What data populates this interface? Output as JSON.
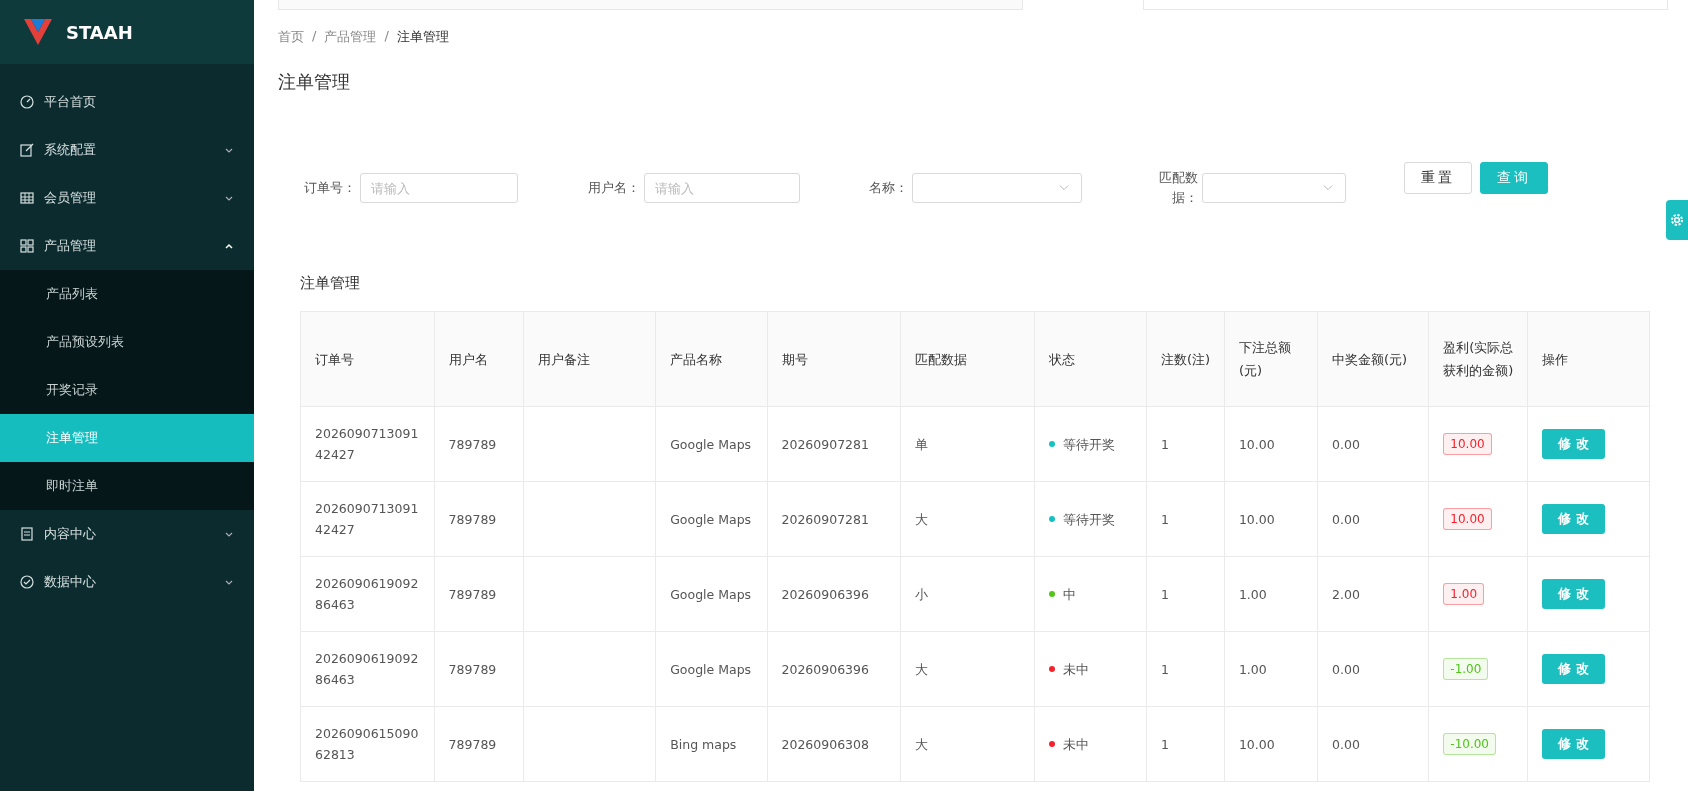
{
  "logo": {
    "text": "STAAH"
  },
  "sidebar": {
    "items": [
      {
        "label": "平台首页",
        "kind": "link",
        "selected": false
      },
      {
        "label": "系统配置",
        "kind": "group",
        "expanded": false
      },
      {
        "label": "会员管理",
        "kind": "group",
        "expanded": false
      },
      {
        "label": "产品管理",
        "kind": "group",
        "expanded": true,
        "children": [
          {
            "label": "产品列表",
            "selected": false
          },
          {
            "label": "产品预设列表",
            "selected": false
          },
          {
            "label": "开奖记录",
            "selected": false
          },
          {
            "label": "注单管理",
            "selected": true
          },
          {
            "label": "即时注单",
            "selected": false
          }
        ]
      },
      {
        "label": "内容中心",
        "kind": "group",
        "expanded": false
      },
      {
        "label": "数据中心",
        "kind": "group",
        "expanded": false
      }
    ]
  },
  "breadcrumb": {
    "separator": "/",
    "items": [
      "首页",
      "产品管理",
      "注单管理"
    ]
  },
  "page_title": "注单管理",
  "filters": [
    {
      "kind": "input",
      "label": "订单号：",
      "placeholder": "请输入"
    },
    {
      "kind": "input",
      "label": "用户名：",
      "placeholder": "请输入"
    },
    {
      "kind": "select",
      "label": "名称："
    },
    {
      "kind": "select",
      "label": "匹配数据："
    }
  ],
  "buttons": [
    {
      "kind": "default",
      "label": "重置"
    },
    {
      "kind": "primary",
      "label": "查询"
    }
  ],
  "table": {
    "title": "注单管理",
    "columns": [
      "订单号",
      "用户名",
      "用户备注",
      "产品名称",
      "期号",
      "匹配数据",
      "状态",
      "注数(注)",
      "下注总额(元)",
      "中奖金额(元)",
      "盈利(实际总获利的金额)",
      "操作"
    ],
    "rows": [
      {
        "order": "202609071309142427",
        "user": "789789",
        "product": "Google Maps",
        "period": "20260907281",
        "match": "单",
        "status": {
          "text": "等待开奖",
          "color": "#13c2c2"
        },
        "count": "1",
        "bet": "10.00",
        "win": "0.00",
        "profit": {
          "text": "10.00",
          "color": "#f5222d"
        },
        "action": "修 改"
      },
      {
        "order": "202609071309142427",
        "user": "789789",
        "product": "Google Maps",
        "period": "20260907281",
        "match": "大",
        "status": {
          "text": "等待开奖",
          "color": "#13c2c2"
        },
        "count": "1",
        "bet": "10.00",
        "win": "0.00",
        "profit": {
          "text": "10.00",
          "color": "#f5222d"
        },
        "action": "修 改"
      },
      {
        "order": "202609061909286463",
        "user": "789789",
        "product": "Google Maps",
        "period": "20260906396",
        "match": "小",
        "status": {
          "text": "中",
          "color": "#52c41a"
        },
        "count": "1",
        "bet": "1.00",
        "win": "2.00",
        "profit": {
          "text": "1.00",
          "color": "#f5222d"
        },
        "action": "修 改"
      },
      {
        "order": "202609061909286463",
        "user": "789789",
        "product": "Google Maps",
        "period": "20260906396",
        "match": "大",
        "status": {
          "text": "未中",
          "color": "#f5222d"
        },
        "count": "1",
        "bet": "1.00",
        "win": "0.00",
        "profit": {
          "text": "-1.00",
          "color": "#52c41a"
        },
        "action": "修 改"
      },
      {
        "order": "202609061509062813",
        "user": "789789",
        "product": "Bing maps",
        "period": "20260906308",
        "match": "大",
        "status": {
          "text": "未中",
          "color": "#f5222d"
        },
        "count": "1",
        "bet": "10.00",
        "win": "0.00",
        "profit": {
          "text": "-10.00",
          "color": "#52c41a"
        },
        "action": "修 改"
      }
    ]
  }
}
